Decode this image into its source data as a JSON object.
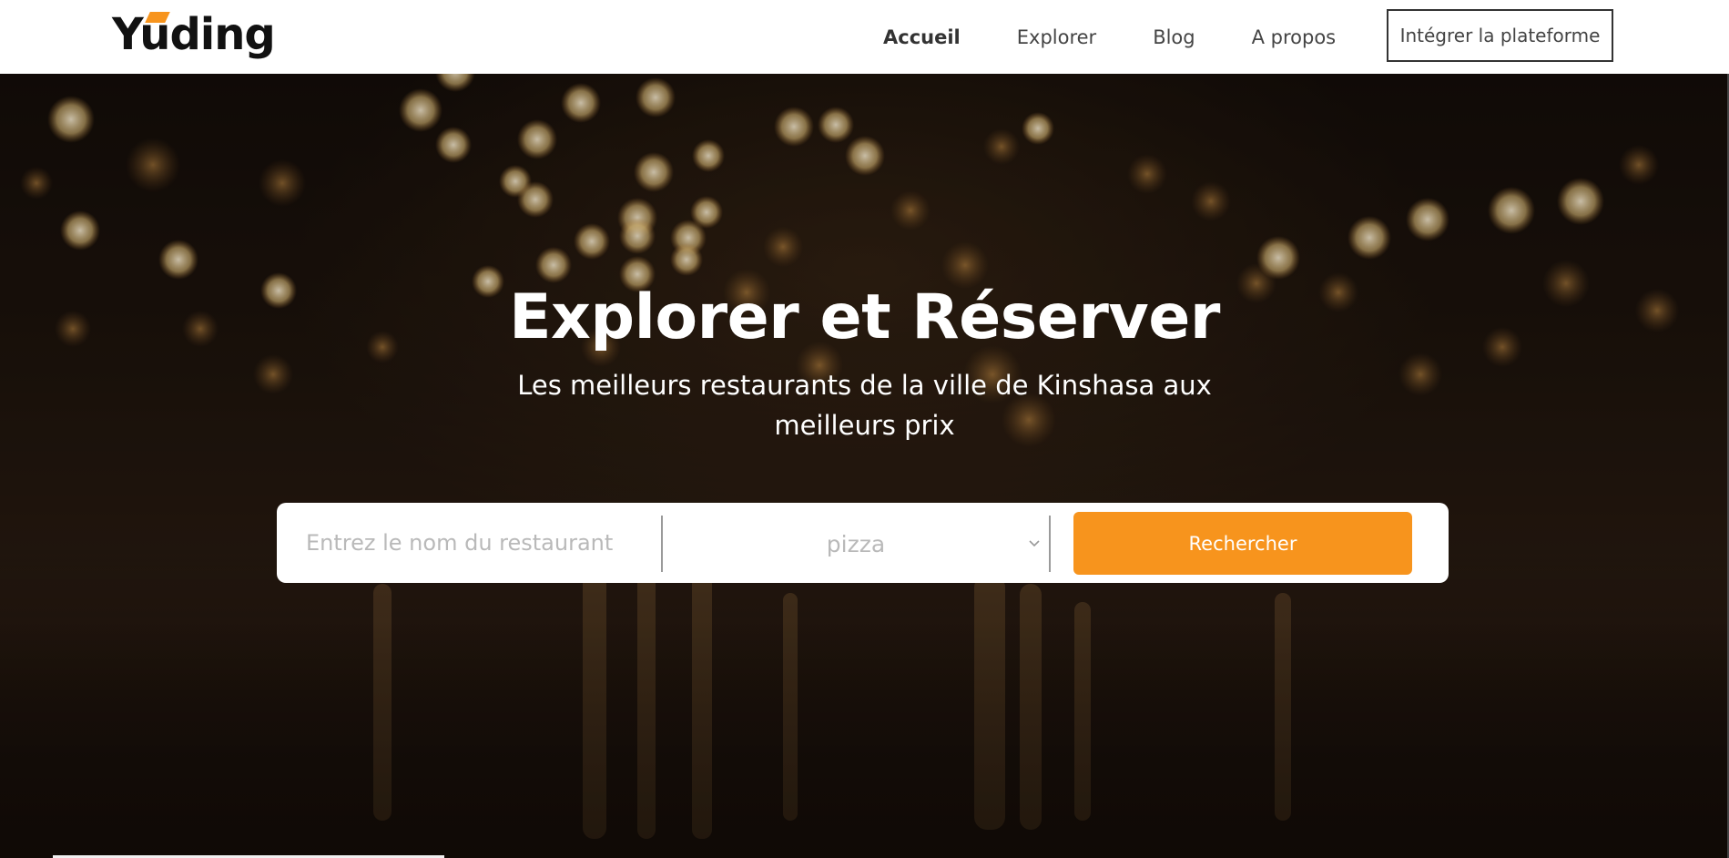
{
  "header": {
    "logo_text": "Yuding",
    "nav_items": [
      {
        "label": "Accueil",
        "active": true
      },
      {
        "label": "Explorer",
        "active": false
      },
      {
        "label": "Blog",
        "active": false
      },
      {
        "label": "A propos",
        "active": false
      }
    ],
    "cta_label": "Intégrer la plateforme"
  },
  "hero": {
    "title": "Explorer et Réserver",
    "subtitle_line1": "Les meilleurs restaurants de la ville de Kinshasa aux",
    "subtitle_line2": "meilleurs prix"
  },
  "search": {
    "placeholder": "Entrez le nom du restaurant",
    "category_selected": "pizza",
    "button_label": "Rechercher"
  },
  "colors": {
    "accent": "#f7941d",
    "nav_text": "#444444",
    "hero_text": "#ffffff",
    "placeholder": "#b9b9b9"
  },
  "icons": {
    "select_chevron": "chevron-down-icon",
    "logo_mark": "logo-accent-icon"
  }
}
